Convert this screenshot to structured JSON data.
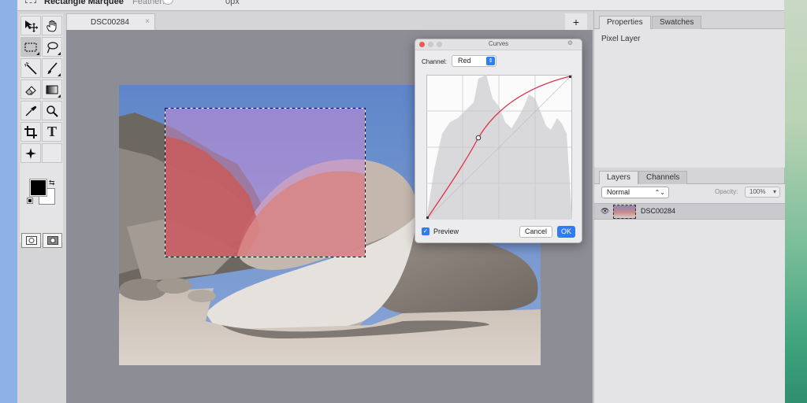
{
  "options_bar": {
    "tool_name": "Rectangle Marquee",
    "feather_label": "Feather:",
    "feather_value": "0px"
  },
  "document": {
    "tab_title": "DSC00284",
    "close_glyph": "×",
    "new_tab_glyph": "+"
  },
  "toolbox": {
    "tools": [
      {
        "name": "move-tool",
        "icon": "move-icon"
      },
      {
        "name": "hand-tool",
        "icon": "hand-icon"
      },
      {
        "name": "rectangle-marquee-tool",
        "icon": "marquee-icon",
        "active": true
      },
      {
        "name": "lasso-tool",
        "icon": "lasso-icon"
      },
      {
        "name": "magic-wand-tool",
        "icon": "magic-wand-icon"
      },
      {
        "name": "brush-tool",
        "icon": "brush-icon"
      },
      {
        "name": "eraser-tool",
        "icon": "eraser-icon"
      },
      {
        "name": "gradient-tool",
        "icon": "gradient-icon"
      },
      {
        "name": "eyedropper-tool",
        "icon": "eyedropper-icon"
      },
      {
        "name": "zoom-tool",
        "icon": "zoom-icon"
      },
      {
        "name": "crop-tool",
        "icon": "crop-icon"
      },
      {
        "name": "type-tool",
        "icon": "type-icon"
      },
      {
        "name": "healing-tool",
        "icon": "sparkle-icon"
      }
    ],
    "type_glyph": "T",
    "swap_glyph": "⇆",
    "foreground_color": "#000000",
    "background_color": "#ffffff"
  },
  "properties_panel": {
    "tabs": [
      "Properties",
      "Swatches"
    ],
    "active_tab": "Properties",
    "layer_kind": "Pixel Layer"
  },
  "layers_panel": {
    "tabs": [
      "Layers",
      "Channels"
    ],
    "active_tab": "Layers",
    "blend_mode": "Normal",
    "opacity_label": "Opacity:",
    "opacity_value": "100%",
    "layers": [
      {
        "name": "DSC00284",
        "visible": true,
        "eye_glyph": "👁"
      }
    ]
  },
  "curves_dialog": {
    "title": "Curves",
    "channel_label": "Channel:",
    "channel_value": "Red",
    "preview_label": "Preview",
    "preview_checked": true,
    "check_glyph": "✓",
    "cancel_label": "Cancel",
    "ok_label": "OK",
    "curve_color": "#e0304a",
    "accent_color": "#2f7cf6"
  }
}
